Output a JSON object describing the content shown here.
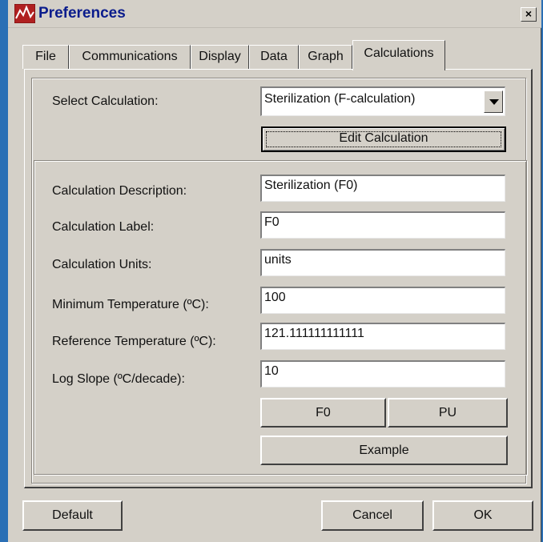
{
  "window": {
    "title": "Preferences",
    "close_glyph": "×"
  },
  "tabs": [
    {
      "label": "File",
      "active": false
    },
    {
      "label": "Communications",
      "active": false
    },
    {
      "label": "Display",
      "active": false
    },
    {
      "label": "Data",
      "active": false
    },
    {
      "label": "Graph",
      "active": false
    },
    {
      "label": "Calculations",
      "active": true
    }
  ],
  "select_calculation": {
    "label": "Select Calculation:",
    "value": "Sterilization (F-calculation)"
  },
  "edit_calculation_label": "Edit Calculation",
  "fields": {
    "description": {
      "label": "Calculation Description:",
      "value": "Sterilization (F0)"
    },
    "label": {
      "label": "Calculation Label:",
      "value": "F0"
    },
    "units": {
      "label": "Calculation Units:",
      "value": "units"
    },
    "min_temp": {
      "label": "Minimum Temperature (ºC):",
      "value": "100"
    },
    "ref_temp": {
      "label": "Reference Temperature (ºC):",
      "value": "121.111111111111"
    },
    "log_slope": {
      "label": "Log Slope (ºC/decade):",
      "value": "10"
    }
  },
  "buttons": {
    "f0": "F0",
    "pu": "PU",
    "example": "Example",
    "default": "Default",
    "cancel": "Cancel",
    "ok": "OK"
  },
  "icons": {
    "app": "application-icon",
    "close": "close-icon",
    "dropdown": "chevron-down-icon"
  },
  "colors": {
    "title_text": "#0a1c8c",
    "face": "#d4d0c8",
    "outside": "#2a6fb5"
  }
}
